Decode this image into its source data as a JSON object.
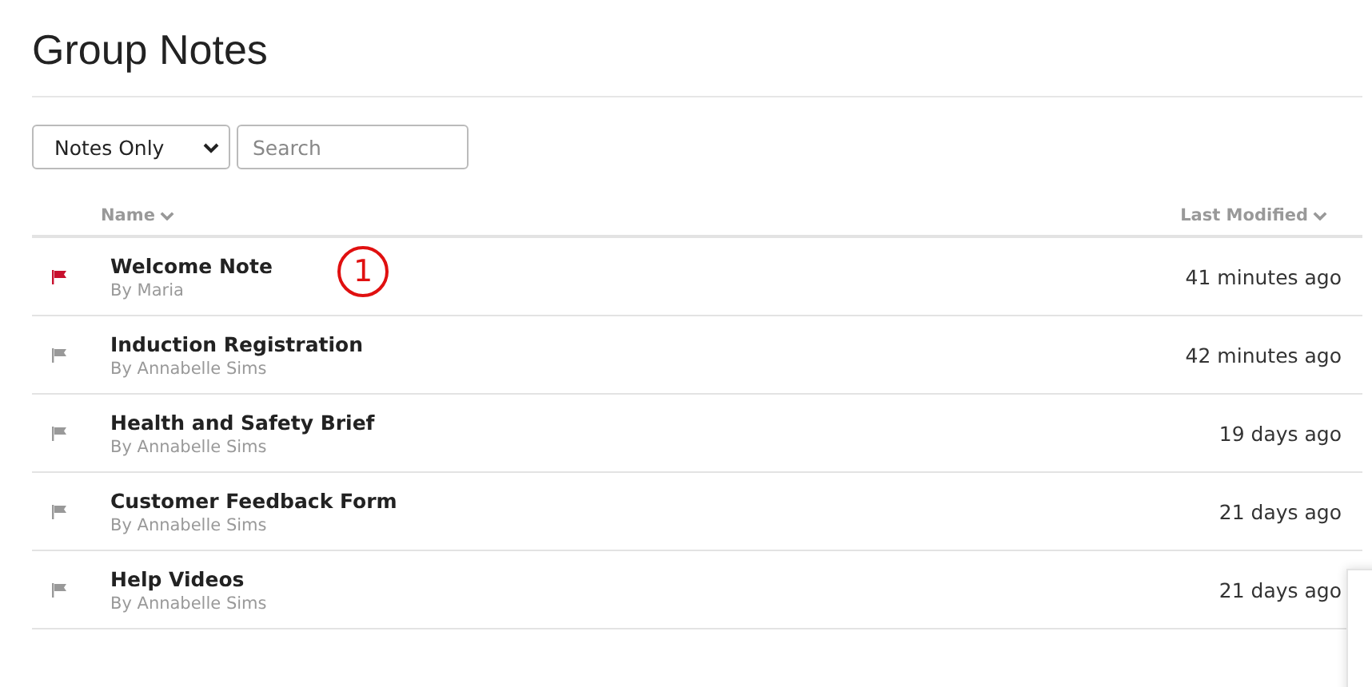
{
  "page": {
    "title": "Group Notes"
  },
  "filter": {
    "value": "Notes Only"
  },
  "search": {
    "placeholder": "Search"
  },
  "columns": [
    {
      "label": "Name"
    },
    {
      "label": "Last Modified"
    }
  ],
  "notes": [
    {
      "title": "Welcome Note",
      "author": "By Maria",
      "modified": "41 minutes ago",
      "flagged": true
    },
    {
      "title": "Induction Registration",
      "author": "By Annabelle Sims",
      "modified": "42 minutes ago",
      "flagged": false
    },
    {
      "title": "Health and Safety Brief",
      "author": "By Annabelle Sims",
      "modified": "19 days ago",
      "flagged": false
    },
    {
      "title": "Customer Feedback Form",
      "author": "By Annabelle Sims",
      "modified": "21 days ago",
      "flagged": false
    },
    {
      "title": "Help Videos",
      "author": "By Annabelle Sims",
      "modified": "21 days ago",
      "flagged": false
    }
  ],
  "callout": {
    "label": "1"
  }
}
